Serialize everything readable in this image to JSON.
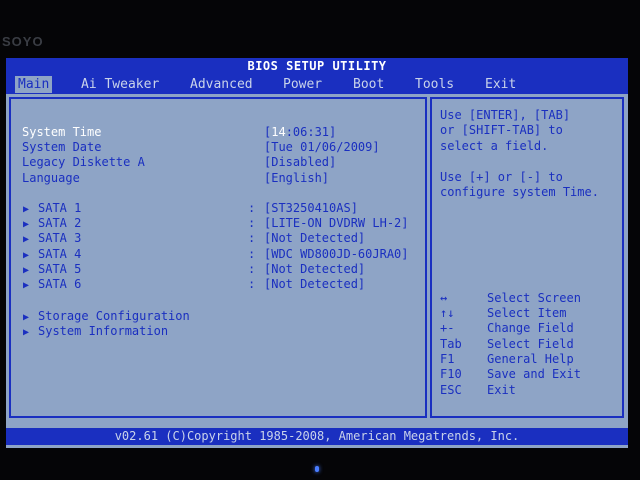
{
  "bezel": {
    "logo": "SOYO"
  },
  "title": "BIOS SETUP UTILITY",
  "menu": [
    "Main",
    "Ai Tweaker",
    "Advanced",
    "Power",
    "Boot",
    "Tools",
    "Exit"
  ],
  "settings": [
    {
      "label": "System Time",
      "value_pre": "[",
      "value_hl": "14",
      "value_post": ":06:31]"
    },
    {
      "label": "System Date",
      "value": "[Tue 01/06/2009]"
    },
    {
      "label": "Legacy Diskette A",
      "value": "[Disabled]"
    },
    {
      "label": "Language",
      "value": "[English]"
    }
  ],
  "sata": [
    {
      "label": "SATA 1",
      "value": "[ST3250410AS]"
    },
    {
      "label": "SATA 2",
      "value": "[LITE-ON DVDRW LH-2]"
    },
    {
      "label": "SATA 3",
      "value": "[Not Detected]"
    },
    {
      "label": "SATA 4",
      "value": "[WDC WD800JD-60JRA0]"
    },
    {
      "label": "SATA 5",
      "value": "[Not Detected]"
    },
    {
      "label": "SATA 6",
      "value": "[Not Detected]"
    }
  ],
  "submenus": [
    {
      "label": "Storage Configuration"
    },
    {
      "label": "System Information"
    }
  ],
  "arrow_glyph": "▶",
  "colon": ":",
  "help": {
    "lines": [
      "Use [ENTER], [TAB]",
      "or [SHIFT-TAB] to",
      "select a field.",
      "",
      "Use [+] or [-] to",
      "configure system Time."
    ]
  },
  "keys": [
    {
      "key": "↔",
      "desc": "Select Screen"
    },
    {
      "key": "↑↓",
      "desc": "Select Item"
    },
    {
      "key": "+-",
      "desc": "Change Field"
    },
    {
      "key": "Tab",
      "desc": "Select Field"
    },
    {
      "key": "F1",
      "desc": "General Help"
    },
    {
      "key": "F10",
      "desc": "Save and Exit"
    },
    {
      "key": "ESC",
      "desc": "Exit"
    }
  ],
  "footer": "v02.61 (C)Copyright 1985-2008, American Megatrends, Inc.",
  "colors": {
    "bar_blue": "#1a2fc0",
    "panel_gray": "#8ea4c6",
    "highlight": "#ffffff"
  }
}
